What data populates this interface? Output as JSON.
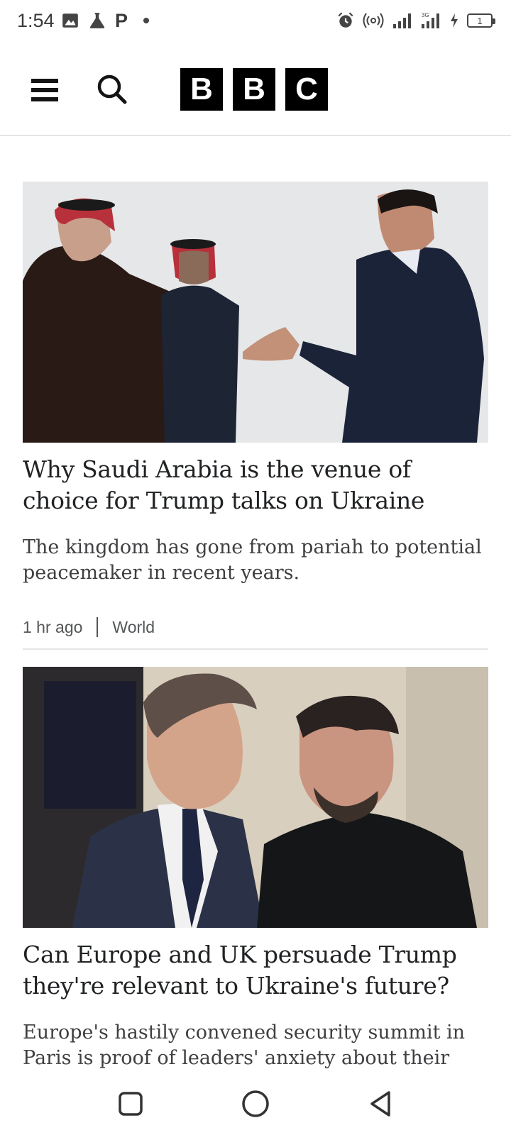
{
  "status_bar": {
    "time": "1:54",
    "left_icons": [
      "image-icon",
      "flask-icon",
      "p-icon",
      "dot-icon"
    ],
    "p_glyph": "P",
    "right_icons": [
      "alarm-icon",
      "hotspot-icon",
      "signal-icon",
      "signal-3g-icon",
      "battery-icon"
    ],
    "battery_level": "1"
  },
  "header": {
    "logo_letters": [
      "B",
      "B",
      "C"
    ]
  },
  "articles": [
    {
      "headline": "Why Saudi Arabia is the venue of choice for Trump talks on Ukraine",
      "summary": "The kingdom has gone from pariah to potential peacemaker in recent years.",
      "time": "1 hr ago",
      "section": "World"
    },
    {
      "headline": "Can Europe and UK persuade Trump they're relevant to Ukraine's future?",
      "summary": "Europe's hastily convened security summit in Paris is proof of leaders' anxiety about their role"
    }
  ],
  "nav_bar": {
    "buttons": [
      "recents-square-icon",
      "home-circle-icon",
      "back-triangle-icon"
    ]
  },
  "colors": {
    "text": "#202224",
    "logo_bg": "#000000",
    "divider": "#e5e5e5"
  }
}
